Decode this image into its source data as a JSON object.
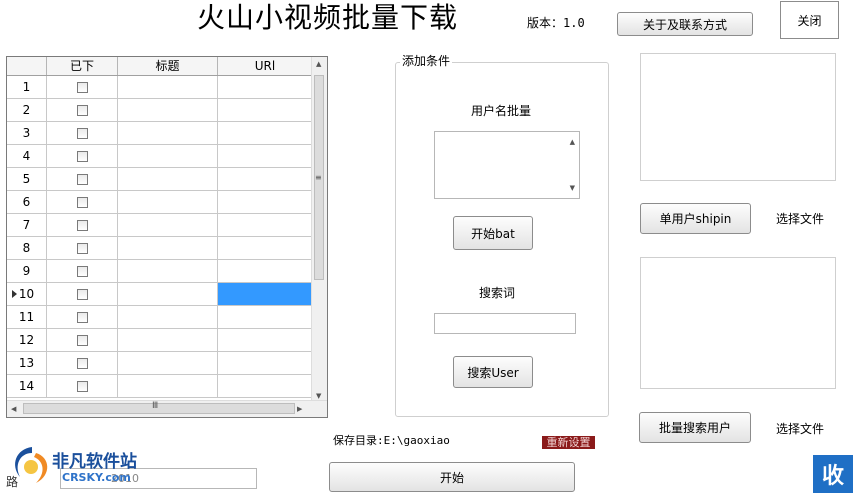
{
  "app": {
    "title": "火山小视频批量下载",
    "version": "版本：1.0",
    "about_button": "关于及联系方式",
    "close_button": "关闭"
  },
  "grid": {
    "columns": [
      "已下",
      "标题",
      "URl"
    ],
    "rows": [
      {
        "num": "1"
      },
      {
        "num": "2"
      },
      {
        "num": "3"
      },
      {
        "num": "4"
      },
      {
        "num": "5"
      },
      {
        "num": "6"
      },
      {
        "num": "7"
      },
      {
        "num": "8"
      },
      {
        "num": "9"
      },
      {
        "num": "10"
      },
      {
        "num": "11"
      },
      {
        "num": "12"
      },
      {
        "num": "13"
      },
      {
        "num": "14"
      }
    ],
    "current_row": "10",
    "scroll_grip_v": "≡",
    "scroll_grip_h": "Ⅲ"
  },
  "conditions": {
    "group_label": "添加条件",
    "username_label": "用户名批量",
    "start_bat_button": "开始bat",
    "search_label": "搜索词",
    "search_user_button": "搜索User"
  },
  "right": {
    "single_user_button": "单用户shipin",
    "choose_file_1": "选择文件",
    "batch_search_button": "批量搜索用户",
    "choose_file_2": "选择文件"
  },
  "bottom": {
    "save_dir": "保存目录:E:\\gaoxiao",
    "reset_button": "重新设置",
    "start_button": "开始",
    "path_label": "路",
    "path_value": "2010",
    "logo_text": "非凡软件站",
    "logo_sub": "CRSKY.com",
    "corner_badge": "收"
  },
  "colors": {
    "selected_cell": "#3399ff",
    "reset_bg": "#8b1a1a"
  }
}
